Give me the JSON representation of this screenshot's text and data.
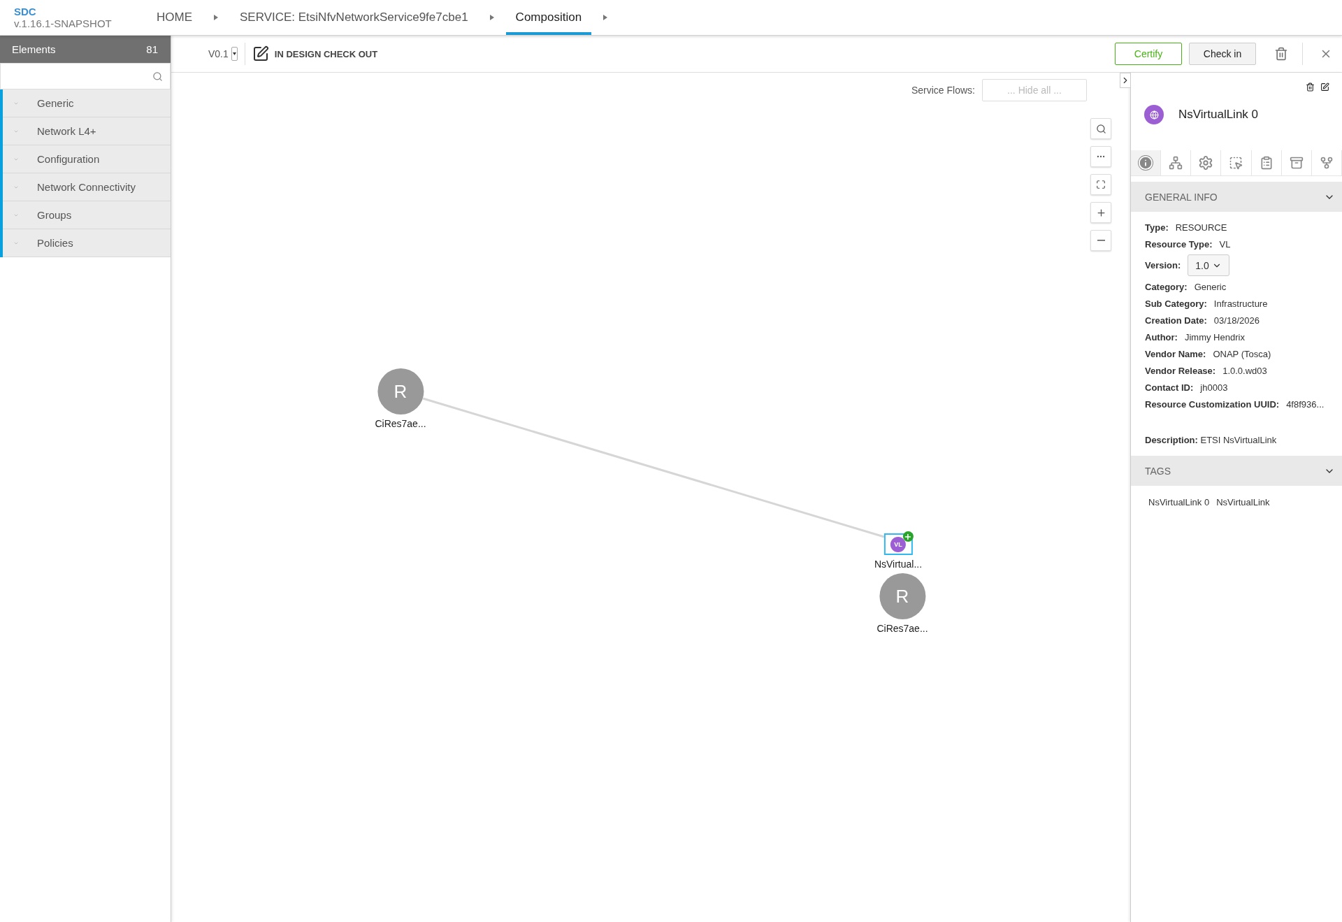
{
  "app": {
    "name": "SDC",
    "version": "v.1.16.1-SNAPSHOT"
  },
  "breadcrumbs": [
    {
      "label": "HOME",
      "selected": false
    },
    {
      "label": "SERVICE: EtsiNfvNetworkService9fe7cbe1",
      "selected": false
    },
    {
      "label": "Composition",
      "selected": true
    }
  ],
  "elements_panel": {
    "title": "Elements",
    "count": "81",
    "categories": [
      "Generic",
      "Network L4+",
      "Configuration",
      "Network Connectivity",
      "Groups",
      "Policies"
    ]
  },
  "toolbar": {
    "version": "V0.1",
    "status": "IN DESIGN CHECK OUT",
    "buttons": [
      {
        "label": "Certify",
        "kind": "primary"
      },
      {
        "label": "Check in",
        "kind": "default"
      }
    ]
  },
  "service_flows": {
    "label": "Service Flows:",
    "placeholder": "... Hide all ..."
  },
  "canvas": {
    "nodes": [
      {
        "kind": "resource",
        "letter": "R",
        "label": "CiRes7ae...",
        "selected": false
      },
      {
        "kind": "link",
        "letter": "VL",
        "label": "NsVirtual...",
        "selected": true
      },
      {
        "kind": "resource",
        "letter": "R",
        "label": "CiRes7ae...",
        "selected": false
      }
    ]
  },
  "details": {
    "name": "NsVirtualLink 0",
    "tabs": [
      {
        "kind": "info",
        "selected": true
      },
      {
        "kind": "composition",
        "selected": false
      },
      {
        "kind": "settings",
        "selected": false
      },
      {
        "kind": "details",
        "selected": false
      },
      {
        "kind": "clipboard",
        "selected": false
      },
      {
        "kind": "archive",
        "selected": false
      },
      {
        "kind": "relations",
        "selected": false
      }
    ],
    "general_info": {
      "title": "GENERAL INFO",
      "fields": [
        {
          "label": "Type:",
          "value": "RESOURCE",
          "kind": "text"
        },
        {
          "label": "Resource Type:",
          "value": "VL",
          "kind": "text"
        },
        {
          "label": "Version:",
          "value": "1.0",
          "kind": "select"
        },
        {
          "label": "Category:",
          "value": "Generic",
          "kind": "text"
        },
        {
          "label": "Sub Category:",
          "value": "Infrastructure",
          "kind": "text"
        },
        {
          "label": "Creation Date:",
          "value": "03/18/2026",
          "kind": "text"
        },
        {
          "label": "Author:",
          "value": "Jimmy Hendrix",
          "kind": "text"
        },
        {
          "label": "Vendor Name:",
          "value": "ONAP (Tosca)",
          "kind": "text"
        },
        {
          "label": "Vendor Release:",
          "value": "1.0.0.wd03",
          "kind": "text"
        },
        {
          "label": "Contact ID:",
          "value": "jh0003",
          "kind": "text"
        },
        {
          "label": "Resource Customization UUID:",
          "value": "4f8f936...",
          "kind": "text"
        }
      ],
      "description": "**Description:** ETSI NsVirtualLink"
    },
    "tags": {
      "title": "TAGS",
      "items": [
        "NsVirtualLink 0",
        "NsVirtualLink"
      ]
    }
  }
}
